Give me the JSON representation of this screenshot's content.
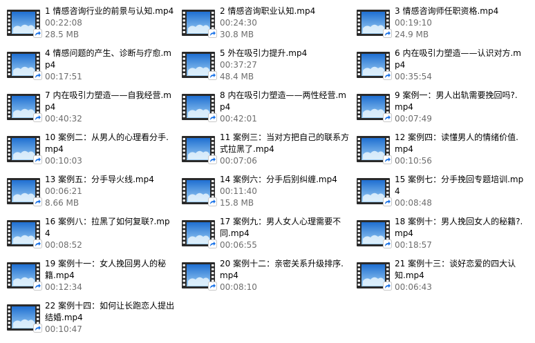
{
  "files": [
    {
      "name": "1 情感咨询行业的前景与认知.mp4",
      "duration": "00:22:08",
      "size": "28.5 MB"
    },
    {
      "name": "2 情感咨询职业认知.mp4",
      "duration": "00:24:30",
      "size": "30.8 MB"
    },
    {
      "name": "3 情感咨询师任职资格.mp4",
      "duration": "00:19:10",
      "size": "24.9 MB"
    },
    {
      "name": "4 情感问题的产生、诊断与疗愈.mp4",
      "duration": "00:17:51",
      "size": ""
    },
    {
      "name": "5 外在吸引力提升.mp4",
      "duration": "00:37:27",
      "size": "48.4 MB"
    },
    {
      "name": "6 内在吸引力塑造——认识对方.mp4",
      "duration": "00:35:54",
      "size": ""
    },
    {
      "name": "7 内在吸引力塑造——自我经营.mp4",
      "duration": "00:40:32",
      "size": ""
    },
    {
      "name": "8 内在吸引力塑造——两性经营.mp4",
      "duration": "00:42:01",
      "size": ""
    },
    {
      "name": "9 案例一：男人出轨需要挽回吗?.mp4",
      "duration": "00:07:49",
      "size": ""
    },
    {
      "name": "10 案例二：从男人的心理看分手.mp4",
      "duration": "00:10:03",
      "size": ""
    },
    {
      "name": "11 案例三：当对方把自己的联系方式拉黑了.mp4",
      "duration": "00:07:06",
      "size": ""
    },
    {
      "name": "12 案例四：读懂男人的情绪价值.mp4",
      "duration": "00:10:56",
      "size": ""
    },
    {
      "name": "13 案例五：分手导火线.mp4",
      "duration": "00:06:21",
      "size": "8.66 MB"
    },
    {
      "name": "14 案例六：分手后别纠缠.mp4",
      "duration": "00:11:40",
      "size": "15.8 MB"
    },
    {
      "name": "15 案例七：分手挽回专题培训.mp4",
      "duration": "00:08:48",
      "size": ""
    },
    {
      "name": "16 案例八：拉黑了如何复联?.mp4",
      "duration": "00:08:52",
      "size": ""
    },
    {
      "name": "17 案例九：男人女人心理需要不同.mp4",
      "duration": "00:06:55",
      "size": ""
    },
    {
      "name": "18 案例十：男人挽回女人的秘籍?.mp4",
      "duration": "00:18:57",
      "size": ""
    },
    {
      "name": "19 案例十一：女人挽回男人的秘籍.mp4",
      "duration": "00:12:34",
      "size": ""
    },
    {
      "name": "20 案例十二：亲密关系升级排序.mp4",
      "duration": "00:08:10",
      "size": ""
    },
    {
      "name": "21 案例十三：谈好恋爱的四大认知.mp4",
      "duration": "00:06:43",
      "size": ""
    },
    {
      "name": "22 案例十四：如何让长跑恋人提出结婚.mp4",
      "duration": "00:10:47",
      "size": ""
    }
  ],
  "icon": {
    "name": "video-file-icon",
    "badge": "shortcut-arrow-icon",
    "film_color": "#2a2a2a",
    "sky_top": "#1f6fd1",
    "sky_bottom": "#9fd0f5",
    "badge_color": "#1a73e8"
  }
}
